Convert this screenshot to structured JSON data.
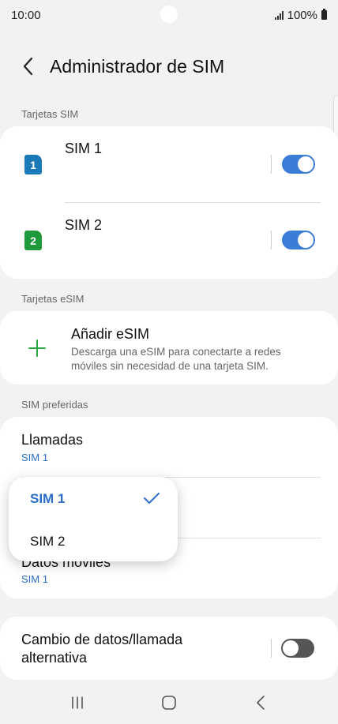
{
  "status": {
    "time": "10:00",
    "battery": "100%"
  },
  "header": {
    "title": "Administrador de SIM"
  },
  "sections": {
    "sim_cards": "Tarjetas SIM",
    "esim_cards": "Tarjetas eSIM",
    "preferred": "SIM preferidas"
  },
  "sims": [
    {
      "name": "SIM 1",
      "number": "1",
      "color": "#1a7ab8",
      "enabled": true
    },
    {
      "name": "SIM 2",
      "number": "2",
      "color": "#1f9a3a",
      "enabled": true
    }
  ],
  "esim": {
    "title": "Añadir eSIM",
    "desc_line1": "Descarga una eSIM para conectarte a redes",
    "desc_line2": "móviles sin necesidad de una tarjeta SIM."
  },
  "preferred": {
    "calls": {
      "title": "Llamadas",
      "value": "SIM 1"
    },
    "data": {
      "title": "Datos móviles",
      "value": "SIM 1"
    }
  },
  "dropdown": {
    "options": [
      {
        "label": "SIM 1",
        "selected": true
      },
      {
        "label": "SIM 2",
        "selected": false
      }
    ]
  },
  "alt": {
    "line1": "Cambio de datos/llamada",
    "line2": "alternativa",
    "enabled": false
  },
  "colors": {
    "accent": "#2a6ec7",
    "toggle_on": "#3a7dd9",
    "plus": "#2aa745"
  }
}
